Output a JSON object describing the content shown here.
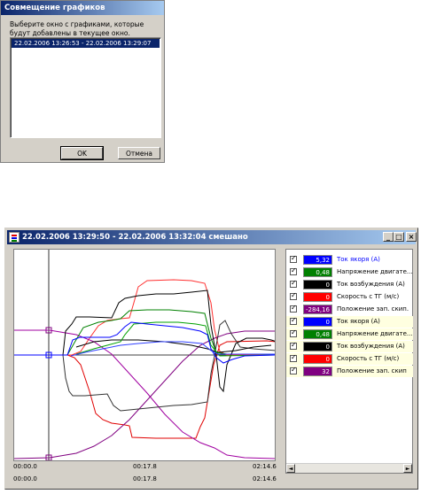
{
  "dialog": {
    "title": "Совмещение графиков",
    "prompt": "Выберите окно с графиками, которые будут добавлены в текущее окно.",
    "list_items": [
      "22.02.2006 13:26:53 - 22.02.2006 13:29:07"
    ],
    "ok_label": "OK",
    "cancel_label": "Отмена"
  },
  "window": {
    "title": "22.02.2006 13:29:50 - 22.02.2006 13:32:04 смешано",
    "minimize_glyph": "_",
    "maximize_glyph": "□",
    "close_glyph": "×"
  },
  "axis": {
    "row1": [
      "00:00.0",
      "00:17.8",
      "02:14.6"
    ],
    "row2": [
      "00:00.0",
      "00:17.8",
      "02:14.6"
    ]
  },
  "legend": {
    "check_glyph": "✓",
    "scroll_left": "◄",
    "scroll_right": "►",
    "items": [
      {
        "value": "5,32",
        "name": "Ток якоря (А)",
        "color": "#0000ff",
        "name_color": "#0000ff",
        "highlight": false
      },
      {
        "value": "0,48",
        "name": "Напряжение двигате...",
        "color": "#008000",
        "name_color": "#000000",
        "highlight": false
      },
      {
        "value": "0",
        "name": "Ток возбуждения (А)",
        "color": "#000000",
        "name_color": "#000000",
        "highlight": false
      },
      {
        "value": "0",
        "name": "Скорость с ТГ (м/с)",
        "color": "#ff0000",
        "name_color": "#000000",
        "highlight": false
      },
      {
        "value": "-284,16",
        "name": "Положение зап. скип.",
        "color": "#800080",
        "name_color": "#000000",
        "highlight": false
      },
      {
        "value": "0",
        "name": "Ток якоря (А)",
        "color": "#0000ff",
        "name_color": "#000000",
        "highlight": true
      },
      {
        "value": "0,48",
        "name": "Напряжение двигате...",
        "color": "#008000",
        "name_color": "#000000",
        "highlight": true
      },
      {
        "value": "0",
        "name": "Ток возбуждения (А)",
        "color": "#000000",
        "name_color": "#000000",
        "highlight": true
      },
      {
        "value": "0",
        "name": "Скорость с ТГ (м/с)",
        "color": "#ff0000",
        "name_color": "#000000",
        "highlight": true
      },
      {
        "value": "32",
        "name": "Положение зап. скип",
        "color": "#800080",
        "name_color": "#000000",
        "highlight": true
      }
    ]
  }
}
